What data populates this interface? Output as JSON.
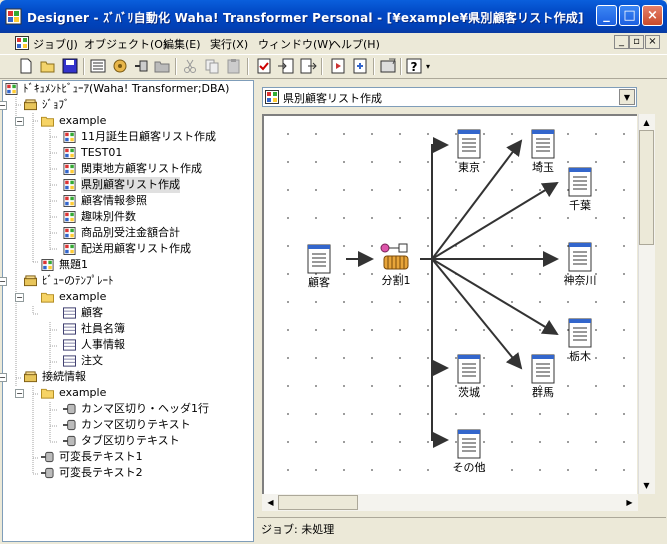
{
  "window": {
    "title": "Designer - ｽﾞﾊﾞﾘ自動化 Waha! Transformer Personal - [¥example¥県別顧客リスト作成]",
    "colors": {
      "titlebar": "#0148c4",
      "canvas_bg": "#ffffff",
      "tree_border": "#7f9db9"
    }
  },
  "menu": [
    {
      "label": "ジョブ(J)"
    },
    {
      "label": "オブジェクト(O)"
    },
    {
      "label": "編集(E)"
    },
    {
      "label": "実行(X)"
    },
    {
      "label": "ウィンドウ(W)"
    },
    {
      "label": "ヘルプ(H)"
    }
  ],
  "toolbar": {
    "icons": [
      "new-file-icon",
      "open-folder-icon",
      "save-icon",
      "list-view-icon",
      "jobs-icon",
      "connector-icon",
      "folder-icon",
      "cut-icon",
      "copy-icon",
      "paste-icon",
      "check-icon",
      "import-icon",
      "export-icon",
      "properties-icon",
      "run-icon",
      "settings-icon",
      "help-icon"
    ]
  },
  "tree": {
    "root": "ﾄﾞｷｭﾒﾝﾄﾋﾞｭｰｱ(Waha! Transformer;DBA)",
    "jobs_label": "ｼﾞｮﾌﾞ",
    "example_label": "example",
    "job_items": [
      "11月誕生日顧客リスト作成",
      "TEST01",
      "関東地方顧客リスト作成",
      "県別顧客リスト作成",
      "顧客情報参照",
      "趣味別件数",
      "商品別受注金額合計",
      "配送用顧客リスト作成"
    ],
    "untitled": "無題1",
    "view_templates_label": "ﾋﾞｭｰのﾃﾝﾌﾟﾚｰﾄ",
    "view_example_label": "example",
    "view_items": [
      "顧客",
      "社員名簿",
      "人事情報",
      "注文"
    ],
    "connections_label": "接続情報",
    "conn_example_label": "example",
    "conn_items": [
      "カンマ区切り・ヘッダ1行",
      "カンマ区切りテキスト",
      "タブ区切りテキスト"
    ],
    "variable_items": [
      "可変長テキスト1",
      "可変長テキスト2"
    ]
  },
  "job_selector": {
    "value": "県別顧客リスト作成"
  },
  "diagram": {
    "source": "顧客",
    "splitter": "分割1",
    "outputs": [
      "東京",
      "埼玉",
      "千葉",
      "神奈川",
      "栃木",
      "茨城",
      "群馬",
      "その他"
    ]
  },
  "status": {
    "text": "ジョブ: 未処理"
  }
}
